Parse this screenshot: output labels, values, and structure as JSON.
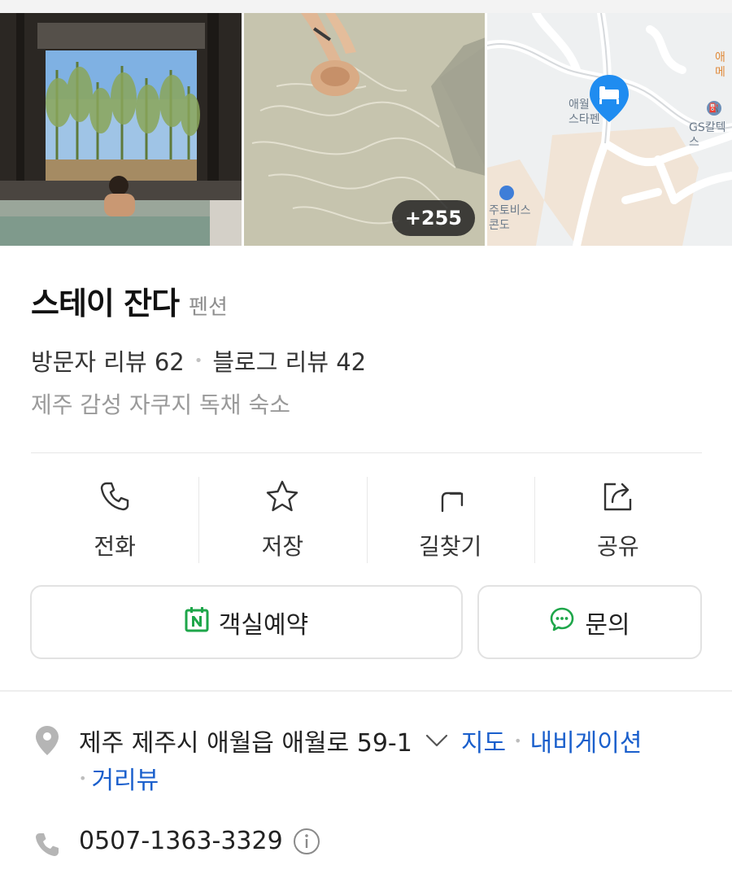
{
  "gallery": {
    "photo_count_badge": "+255",
    "map_labels": {
      "hotel": "애월\n스타펜",
      "gas": "GS칼텍스",
      "condo": "주토비스\n콘도",
      "corner": "애\n메"
    }
  },
  "place": {
    "name": "스테이 잔다",
    "category": "펜션",
    "visitor_reviews": "방문자 리뷰 62",
    "blog_reviews": "블로그 리뷰 42",
    "description": "제주 감성 자쿠지 독채 숙소"
  },
  "actions": [
    {
      "label": "전화",
      "icon": "phone-icon"
    },
    {
      "label": "저장",
      "icon": "star-icon"
    },
    {
      "label": "길찾기",
      "icon": "directions-icon"
    },
    {
      "label": "공유",
      "icon": "share-icon"
    }
  ],
  "buttons": {
    "reserve_label": "객실예약",
    "inquiry_label": "문의"
  },
  "info": {
    "address": "제주 제주시 애월읍 애월로 59-1",
    "map_link": "지도",
    "navigation_link": "내비게이션",
    "street_view_link": "거리뷰",
    "phone": "0507-1363-3329"
  },
  "colors": {
    "link": "#1a5fcc",
    "naver_green": "#1ea64a",
    "map_pin": "#1f8cf0"
  }
}
